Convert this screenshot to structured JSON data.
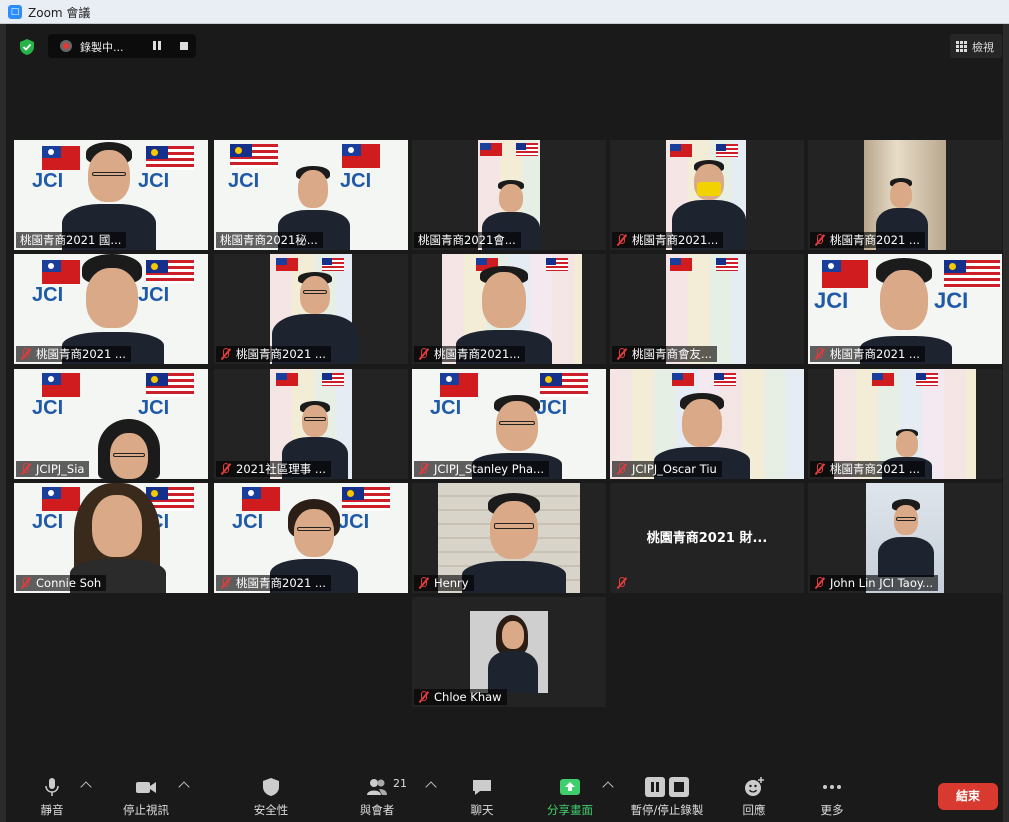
{
  "window": {
    "app_icon_glyph": "□",
    "title": "Zoom 會議"
  },
  "top_bar": {
    "recording_label": "錄製中...",
    "view_label": "檢視"
  },
  "tiles": [
    {
      "name": "桃園青商2021 國...",
      "muted": false,
      "active": true
    },
    {
      "name": "桃園青商2021秘...",
      "muted": false
    },
    {
      "name": "桃園青商2021會...",
      "muted": false
    },
    {
      "name": "桃園青商2021...",
      "muted": true
    },
    {
      "name": "桃園青商2021 ...",
      "muted": true
    },
    {
      "name": "桃園青商2021 ...",
      "muted": true
    },
    {
      "name": "桃園青商2021 ...",
      "muted": true
    },
    {
      "name": "桃園青商2021...",
      "muted": true
    },
    {
      "name": "桃園青商會友...",
      "muted": true
    },
    {
      "name": "桃園青商2021 ...",
      "muted": true
    },
    {
      "name": "JCIPJ_Sia",
      "muted": true
    },
    {
      "name": "2021社區理事 ...",
      "muted": true
    },
    {
      "name": "JCIPJ_Stanley Pha...",
      "muted": true
    },
    {
      "name": "JCIPJ_Oscar Tiu",
      "muted": true
    },
    {
      "name": "桃園青商2021 ...",
      "muted": true
    },
    {
      "name": "Connie Soh",
      "muted": true
    },
    {
      "name": "桃園青商2021 ...",
      "muted": true
    },
    {
      "name": "Henry",
      "muted": true
    },
    {
      "name": "",
      "muted": true,
      "center_name": "桃園青商2021 財..."
    },
    {
      "name": "John Lin JCI Taoy...",
      "muted": true
    },
    {
      "name": "Chloe Khaw",
      "muted": true
    }
  ],
  "jci_logo_text": "JCI",
  "toolbar": {
    "mute": "靜音",
    "stop_video": "停止視訊",
    "security": "安全性",
    "participants": "與會者",
    "participants_count": "21",
    "chat": "聊天",
    "share_screen": "分享畫面",
    "pause_stop_recording": "暫停/停止錄製",
    "reactions": "回應",
    "more": "更多",
    "end": "結束"
  },
  "colors": {
    "active_speaker": "#c7e36b",
    "end_button": "#d93a30",
    "share_green": "#3fce6c",
    "muted_red": "#e23b3b"
  }
}
